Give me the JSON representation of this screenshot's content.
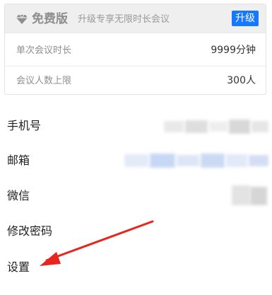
{
  "plan": {
    "icon": "diamond-icon",
    "name": "免费版",
    "description": "升级专享无限时长会议",
    "upgrade_label": "升级",
    "accent_color": "#1677ff",
    "limits": [
      {
        "label": "单次会议时长",
        "value": "9999分钟"
      },
      {
        "label": "会议人数上限",
        "value": "300人"
      }
    ]
  },
  "account": {
    "items": [
      {
        "label": "手机号",
        "value_hidden": true
      },
      {
        "label": "邮箱",
        "value_hidden": true
      },
      {
        "label": "微信",
        "value_hidden": true
      },
      {
        "label": "修改密码"
      },
      {
        "label": "设置"
      }
    ]
  },
  "annotation": {
    "arrow_color": "#e8251f",
    "points_to": "设置"
  }
}
